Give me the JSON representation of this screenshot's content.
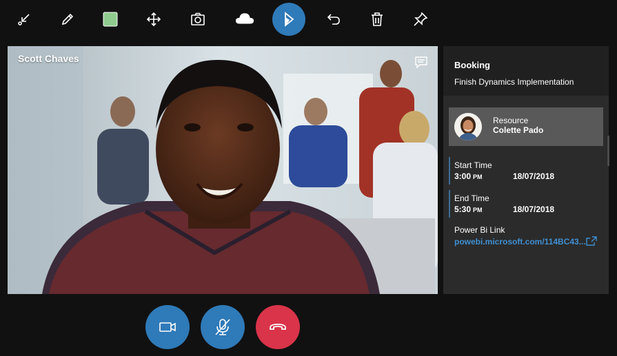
{
  "toolbar": {
    "buttons": [
      {
        "name": "collapse-icon"
      },
      {
        "name": "pencil-icon"
      },
      {
        "name": "color-swatch",
        "color": "#8fcb8f"
      },
      {
        "name": "move-icon"
      },
      {
        "name": "camera-icon"
      },
      {
        "name": "cloud-icon"
      },
      {
        "name": "dynamics-icon",
        "active": true
      },
      {
        "name": "undo-icon"
      },
      {
        "name": "trash-icon"
      },
      {
        "name": "pin-icon"
      }
    ]
  },
  "video": {
    "caller_name": "Scott Chaves"
  },
  "panel": {
    "title": "Booking",
    "subtitle": "Finish Dynamics Implementation",
    "resource": {
      "label": "Resource",
      "name": "Colette Pado"
    },
    "start": {
      "label": "Start Time",
      "time": "3:00",
      "ampm": "PM",
      "date": "18/07/2018"
    },
    "end": {
      "label": "End Time",
      "time": "5:30",
      "ampm": "PM",
      "date": "18/07/2018"
    },
    "link": {
      "label": "Power Bi Link",
      "url": "powebi.microsoft.com/114BC43..."
    }
  },
  "controls": [
    {
      "name": "video-camera-icon"
    },
    {
      "name": "mute-microphone-icon"
    },
    {
      "name": "hang-up-icon"
    }
  ],
  "colors": {
    "accent": "#2f7ab8",
    "hangup": "#d9344a",
    "link": "#3f8fd2",
    "panel": "#2b2b2b",
    "background": "#111111"
  }
}
